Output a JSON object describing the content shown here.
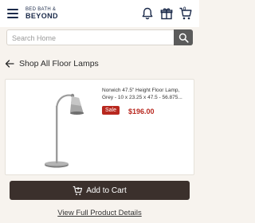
{
  "header": {
    "logo_line1": "BED BATH &",
    "logo_line2": "BEYOND",
    "cart_count": "0"
  },
  "search": {
    "placeholder": "Search Home"
  },
  "back": {
    "label": "Shop All Floor Lamps"
  },
  "product": {
    "name": "Norwich 47.5\" Height Floor Lamp, Grey - 10 x 23.25 x 47.5 - 56.875...",
    "sale_badge": "Sale",
    "price": "$196.00"
  },
  "actions": {
    "add_to_cart": "Add to Cart",
    "view_details": "View Full Product Details"
  },
  "colors": {
    "brand_navy": "#1b2a4a",
    "sale_red": "#b8281f",
    "button_dark": "#3b302c",
    "background": "#f7f3ee"
  },
  "icons": {
    "menu": "hamburger-menu-icon",
    "notifications": "bell-icon",
    "gifts": "gift-icon",
    "cart": "shopping-cart-icon",
    "search": "search-icon",
    "back": "arrow-left-icon"
  }
}
